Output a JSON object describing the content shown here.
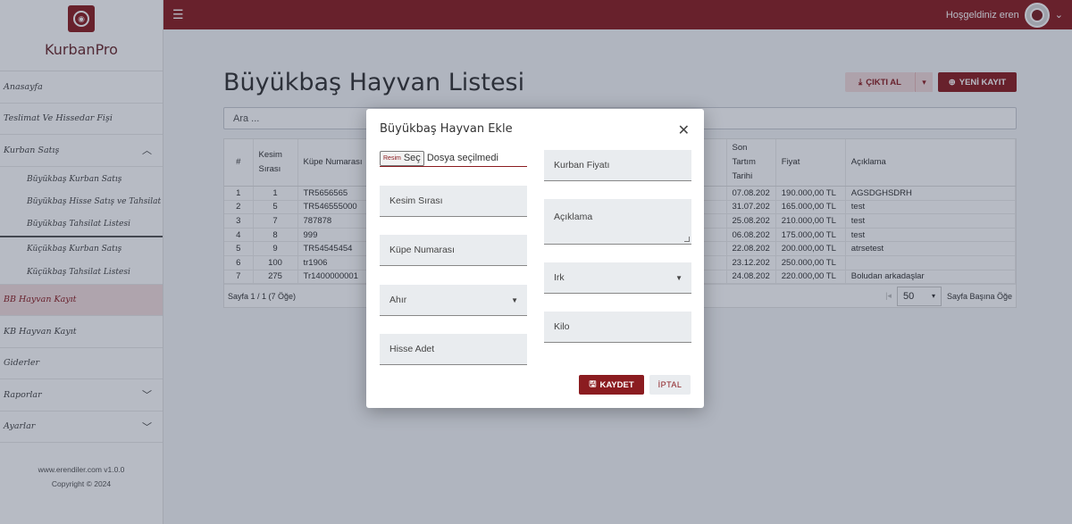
{
  "app": {
    "brand": "KurbanPro",
    "footer_site": "www.erendiler.com v1.0.0",
    "footer_copyright": "Copyright © 2024"
  },
  "sidebar": {
    "items": [
      {
        "label": "Anasayfa"
      },
      {
        "label": "Teslimat Ve Hissedar Fişi"
      },
      {
        "label": "Kurban Satış"
      },
      {
        "label": "BB Hayvan Kayıt"
      },
      {
        "label": "KB Hayvan Kayıt"
      },
      {
        "label": "Giderler"
      },
      {
        "label": "Raporlar"
      },
      {
        "label": "Ayarlar"
      }
    ],
    "sub_items": [
      {
        "label": "Büyükbaş Kurban Satış"
      },
      {
        "label": "Büyükbaş Hisse Satış ve Tahsilat"
      },
      {
        "label": "Büyükbaş Tahsilat Listesi"
      },
      {
        "label": "Küçükbaş Kurban Satış"
      },
      {
        "label": "Küçükbaş Tahsilat Listesi"
      }
    ]
  },
  "topbar": {
    "welcome": "Hoşgeldiniz eren"
  },
  "page": {
    "title": "Büyükbaş Hayvan Listesi",
    "cikti_label": "ÇIKTI AL",
    "yeni_label": "YENİ KAYIT",
    "search_placeholder": "Ara ..."
  },
  "table": {
    "headers": [
      "#",
      "Kesim Sırası",
      "Küpe Numarası",
      "Son Tartım Tarihi",
      "Fiyat",
      "Açıklama"
    ],
    "rows": [
      [
        "1",
        "1",
        "TR5656565",
        "07.08.202",
        "190.000,00 TL",
        "AGSDGHSDRH"
      ],
      [
        "2",
        "5",
        "TR546555000",
        "31.07.202",
        "165.000,00 TL",
        "test"
      ],
      [
        "3",
        "7",
        "787878",
        "25.08.202",
        "210.000,00 TL",
        "test"
      ],
      [
        "4",
        "8",
        "999",
        "06.08.202",
        "175.000,00 TL",
        "test"
      ],
      [
        "5",
        "9",
        "TR54545454",
        "22.08.202",
        "200.000,00 TL",
        "atrsetest"
      ],
      [
        "6",
        "100",
        "tr1906",
        "23.12.202",
        "250.000,00 TL",
        ""
      ],
      [
        "7",
        "275",
        "Tr1400000001",
        "24.08.202",
        "220.000,00 TL",
        "Boludan arkadaşlar"
      ]
    ],
    "page_info": "Sayfa 1 / 1 (7 Öğe)",
    "per_page": "50",
    "per_page_label": "Sayfa Başına Öğe"
  },
  "modal": {
    "title": "Büyükbaş Hayvan Ekle",
    "file_button_small": "Resim",
    "file_button": "Seç",
    "file_status": "Dosya seçilmedi",
    "kesim_sirasi": "Kesim Sırası",
    "kupe_numarasi": "Küpe Numarası",
    "ahir": "Ahır",
    "hisse_adet": "Hisse Adet",
    "kurban_fiyati": "Kurban Fiyatı",
    "aciklama": "Açıklama",
    "irk": "Irk",
    "kilo": "Kilo",
    "save_label": "KAYDET",
    "cancel_label": "İPTAL"
  },
  "colors": {
    "brand": "#8b1c20"
  }
}
